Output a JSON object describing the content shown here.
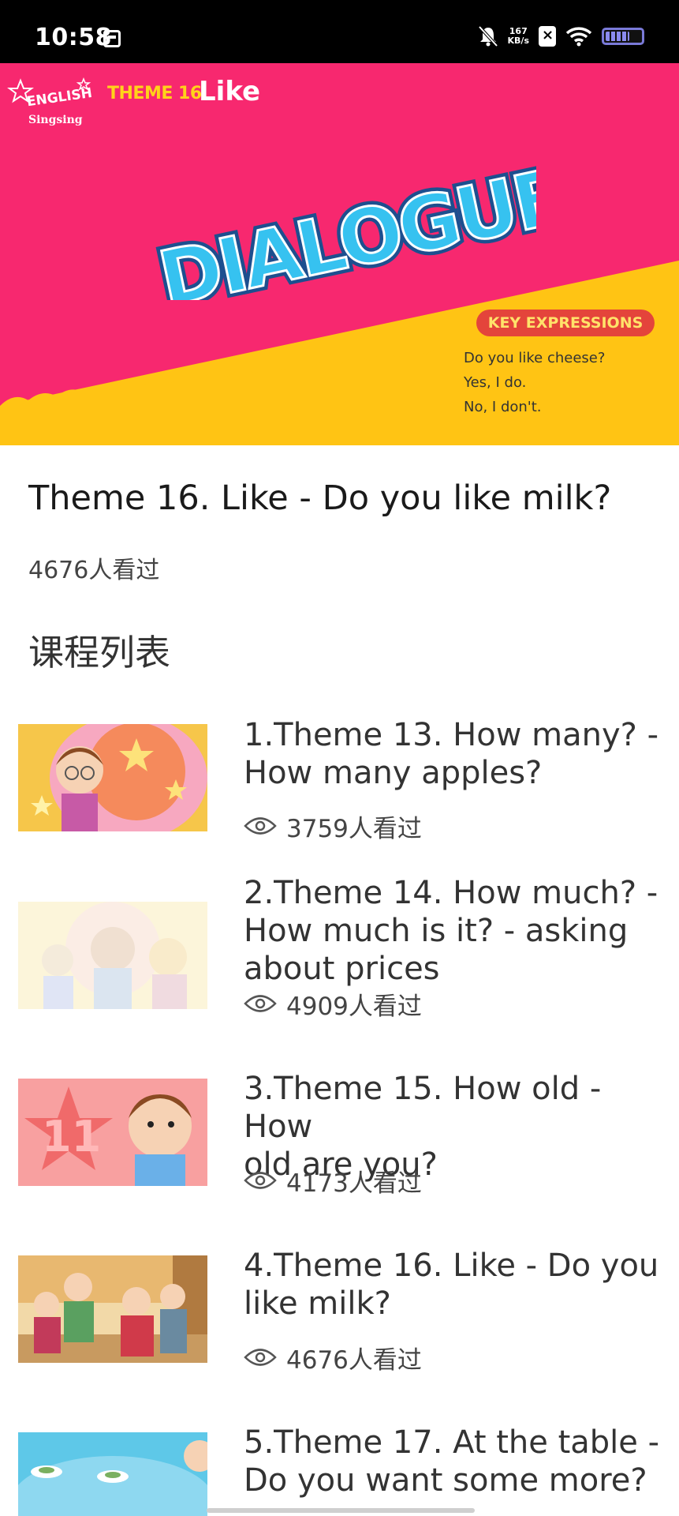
{
  "status_bar": {
    "time": "10:58",
    "net_speed_value": "167",
    "net_speed_unit": "KB/s",
    "icons": [
      "notification-icon",
      "mute-icon",
      "sim-icon",
      "wifi-icon",
      "battery-icon"
    ]
  },
  "banner": {
    "logo_text_1": "ENGLISH",
    "logo_text_2": "Singsing",
    "theme_label": "THEME 16",
    "theme_word": "Like",
    "headline": "DIALOGUE",
    "key_expressions_label": "KEY EXPRESSIONS",
    "key_lines": [
      "Do you like cheese?",
      "Yes, I do.",
      "No, I don't."
    ],
    "colors": {
      "pink": "#f7286f",
      "yellow": "#ffc414",
      "blue": "#27b5e8"
    }
  },
  "video": {
    "title": "Theme 16. Like - Do you like milk?",
    "views": "4676人看过"
  },
  "course_list": {
    "heading": "课程列表",
    "items": [
      {
        "title_line1": "1.Theme 13. How many?   -",
        "title_line2": "How many apples?",
        "title_line3": "",
        "views": "3759人看过"
      },
      {
        "title_line1": "2.Theme 14. How much?   -",
        "title_line2": "How much is it?   - asking",
        "title_line3": "about prices",
        "views": "4909人看过"
      },
      {
        "title_line1": "3.Theme 15. How old - How",
        "title_line2": "old are you?",
        "title_line3": "",
        "views": "4173人看过"
      },
      {
        "title_line1": "4.Theme 16. Like - Do you",
        "title_line2": "like milk?",
        "title_line3": "",
        "views": "4676人看过"
      },
      {
        "title_line1": "5.Theme 17. At the table -",
        "title_line2": "Do you want some more?",
        "title_line3": "",
        "views": ""
      }
    ]
  }
}
